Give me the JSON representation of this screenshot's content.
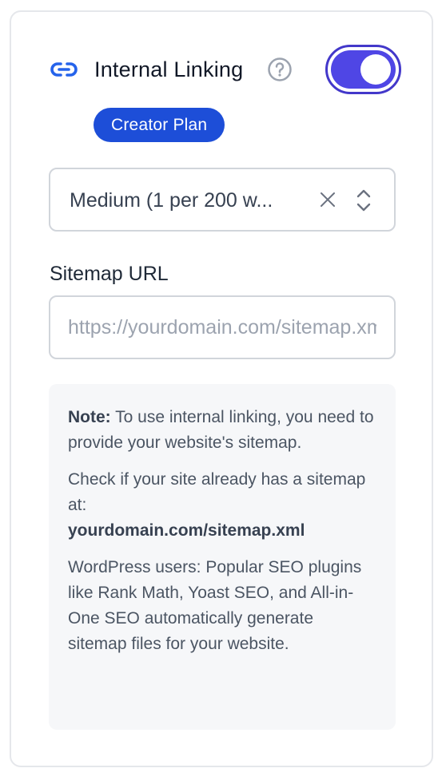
{
  "header": {
    "title": "Internal Linking",
    "toggle_on": true
  },
  "plan_badge": "Creator Plan",
  "frequency_select": {
    "value": "Medium (1 per 200 w..."
  },
  "sitemap": {
    "label": "Sitemap URL",
    "placeholder": "https://yourdomain.com/sitemap.xml",
    "value": ""
  },
  "note": {
    "lead": "Note:",
    "paragraph1": " To use internal linking, you need to provide your website's sitemap.",
    "paragraph2": "Check if your site already has a sitemap at:",
    "sitemap_path": "yourdomain.com/sitemap.xml",
    "paragraph3": "WordPress users: Popular SEO plugins like Rank Math, Yoast SEO, and All-in-One SEO automatically generate sitemap files for your website."
  },
  "colors": {
    "accent": "#4f46e5",
    "badge": "#1d4ed8",
    "link_icon": "#2563eb"
  },
  "icons": {
    "link": "link-icon",
    "help": "help-circle-icon",
    "clear": "close-icon",
    "select": "chevron-up-down-icon"
  }
}
